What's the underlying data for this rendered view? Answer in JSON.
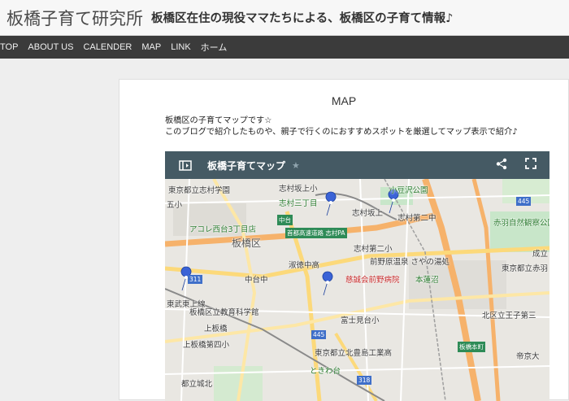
{
  "header": {
    "site_title": "板橋子育て研究所",
    "site_description": "板橋区在住の現役ママたちによる、板橋区の子育て情報♪"
  },
  "nav": {
    "items": [
      "TOP",
      "ABOUT US",
      "CALENDER",
      "MAP",
      "LINK",
      "ホーム"
    ]
  },
  "page": {
    "title": "MAP",
    "intro_line1": "板橋区の子育てマップです☆",
    "intro_line2": "このブログで紹介したものや、親子で行くのにおすすめスポットを厳選してマップ表示で紹介♪"
  },
  "map": {
    "title": "板橋子育てマップ",
    "labels": {
      "shimura_gakuen": "東京都立志村学園",
      "shimurasakaue_sho": "志村坂上小",
      "koazawa_park": "小豆沢公園",
      "shimura_sanchome": "志村三丁目",
      "gogoshi": "五小",
      "shimura_sakaue": "志村坂上",
      "shimura_daini_chu": "志村第二中",
      "akabane_park": "赤羽自然観察公園",
      "acole": "アコレ西台3丁目店",
      "nakadai": "中台",
      "shutoko": "首都高速道路 志村PA",
      "ward": "板橋区",
      "shimura_daini_sho": "志村第二小",
      "narimasu": "成立",
      "maenohara_onsen": "前野原温泉 さやの湯処",
      "shukuchu": "淑徳中高",
      "hospital": "慈誠会前野病院",
      "hasunuma": "本蓮沼",
      "akabane_kogyo": "東京都立赤羽",
      "nakadai_chu": "中台中",
      "line_tojo": "東武東上線",
      "kyoikukagaku": "板橋区立教育科学館",
      "fujimidai_sho": "富士見台小",
      "kitaku": "北区立王子第三",
      "kamiitabashi": "上板橋",
      "kamiitabashi_daiyon": "上板橋第四小",
      "kitatoshima": "東京都立北豊島工業高",
      "teikyo": "帝京大",
      "itabashi_honcho": "板橋本町",
      "tokiwadai": "ときわ台",
      "joho": "都立城北",
      "route_311": "311",
      "route_445": "445",
      "route_318": "318"
    }
  },
  "colors": {
    "toolbar": "#455a64",
    "nav_bg": "#3b3b3b",
    "pin": "#3b63d6"
  }
}
